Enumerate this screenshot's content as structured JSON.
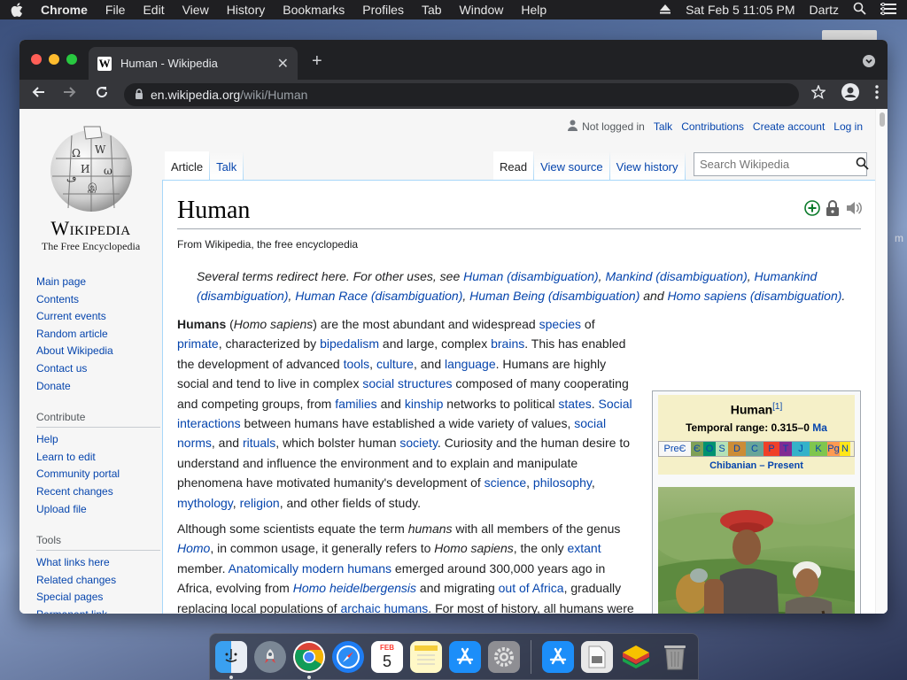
{
  "menubar": {
    "app_name": "Chrome",
    "items": [
      "File",
      "Edit",
      "View",
      "History",
      "Bookmarks",
      "Profiles",
      "Tab",
      "Window",
      "Help"
    ],
    "datetime": "Sat Feb 5  11:05 PM",
    "user": "Dartz"
  },
  "desktop": {
    "side_label": "m"
  },
  "browser": {
    "tab_title": "Human - Wikipedia",
    "favicon_letter": "W",
    "url_host": "en.wikipedia.org",
    "url_path": "/wiki/Human"
  },
  "wiki": {
    "wordmark": "Wikipedia",
    "tagline": "The Free Encyclopedia",
    "nav": [
      "Main page",
      "Contents",
      "Current events",
      "Random article",
      "About Wikipedia",
      "Contact us",
      "Donate"
    ],
    "contribute_heading": "Contribute",
    "contribute": [
      "Help",
      "Learn to edit",
      "Community portal",
      "Recent changes",
      "Upload file"
    ],
    "tools_heading": "Tools",
    "tools": [
      "What links here",
      "Related changes",
      "Special pages",
      "Permanent link"
    ],
    "personal": {
      "not_logged_in": "Not logged in",
      "talk": "Talk",
      "contributions": "Contributions",
      "create_account": "Create account",
      "log_in": "Log in"
    },
    "tabs_left": [
      "Article",
      "Talk"
    ],
    "tabs_right": [
      "Read",
      "View source",
      "View history"
    ],
    "search_placeholder": "Search Wikipedia",
    "title": "Human",
    "sitesub": "From Wikipedia, the free encyclopedia",
    "hatnote": {
      "prefix": "Several terms redirect here. For other uses, see ",
      "l1": "Human (disambiguation)",
      "s1": ", ",
      "l2": "Mankind (disambiguation)",
      "s2": ", ",
      "l3": "Humankind (disambiguation)",
      "s3": ", ",
      "l4": "Human Race (disambiguation)",
      "s4": ", ",
      "l5": "Human Being (disambiguation)",
      "s5": " and ",
      "l6": "Homo sapiens (disambiguation)",
      "s6": "."
    },
    "para1": [
      {
        "t": "Humans",
        "b": true
      },
      {
        "t": " ("
      },
      {
        "t": "Homo sapiens",
        "i": true
      },
      {
        "t": ") are the most abundant and widespread "
      },
      {
        "t": "species",
        "l": true
      },
      {
        "t": " of "
      },
      {
        "t": "primate",
        "l": true
      },
      {
        "t": ", characterized by "
      },
      {
        "t": "bipedalism",
        "l": true
      },
      {
        "t": " and large, complex "
      },
      {
        "t": "brains",
        "l": true
      },
      {
        "t": ". This has enabled the development of advanced "
      },
      {
        "t": "tools",
        "l": true
      },
      {
        "t": ", "
      },
      {
        "t": "culture",
        "l": true
      },
      {
        "t": ", and "
      },
      {
        "t": "language",
        "l": true
      },
      {
        "t": ". Humans are highly social and tend to live in complex "
      },
      {
        "t": "social structures",
        "l": true
      },
      {
        "t": " composed of many cooperating and competing groups, from "
      },
      {
        "t": "families",
        "l": true
      },
      {
        "t": " and "
      },
      {
        "t": "kinship",
        "l": true
      },
      {
        "t": " networks to political "
      },
      {
        "t": "states",
        "l": true
      },
      {
        "t": ". "
      },
      {
        "t": "Social interactions",
        "l": true
      },
      {
        "t": " between humans have established a wide variety of values, "
      },
      {
        "t": "social norms",
        "l": true
      },
      {
        "t": ", and "
      },
      {
        "t": "rituals",
        "l": true
      },
      {
        "t": ", which bolster human "
      },
      {
        "t": "society",
        "l": true
      },
      {
        "t": ". Curiosity and the human desire to understand and influence the environment and to explain and manipulate phenomena have motivated humanity's development of "
      },
      {
        "t": "science",
        "l": true
      },
      {
        "t": ", "
      },
      {
        "t": "philosophy",
        "l": true
      },
      {
        "t": ", "
      },
      {
        "t": "mythology",
        "l": true
      },
      {
        "t": ", "
      },
      {
        "t": "religion",
        "l": true
      },
      {
        "t": ", and other fields of study."
      }
    ],
    "para2": [
      {
        "t": "Although some scientists equate the term "
      },
      {
        "t": "humans",
        "i": true
      },
      {
        "t": " with all members of the genus "
      },
      {
        "t": "Homo",
        "l": true,
        "i": true
      },
      {
        "t": ", in common usage, it generally refers to "
      },
      {
        "t": "Homo sapiens",
        "i": true
      },
      {
        "t": ", the only "
      },
      {
        "t": "extant",
        "l": true
      },
      {
        "t": " member. "
      },
      {
        "t": "Anatomically modern humans",
        "l": true
      },
      {
        "t": " emerged around 300,000 years ago in Africa, evolving from "
      },
      {
        "t": "Homo heidelbergensis",
        "l": true,
        "i": true
      },
      {
        "t": " and migrating "
      },
      {
        "t": "out of Africa",
        "l": true
      },
      {
        "t": ", gradually replacing local populations of "
      },
      {
        "t": "archaic humans",
        "l": true
      },
      {
        "t": ". For most of history, all humans were"
      }
    ],
    "infobox": {
      "title": "Human",
      "ref": "[1]",
      "range_label": "Temporal range: 0.315–0 ",
      "range_link": "Ma",
      "timeline": [
        {
          "label": "PreЄ",
          "color": "#f7f7f7",
          "w": 36
        },
        {
          "label": "Є",
          "color": "#7fa056",
          "w": 14
        },
        {
          "label": "O",
          "color": "#009270",
          "w": 14
        },
        {
          "label": "S",
          "color": "#b3e1b6",
          "w": 14
        },
        {
          "label": "D",
          "color": "#cb8c37",
          "w": 20
        },
        {
          "label": "C",
          "color": "#67a599",
          "w": 20
        },
        {
          "label": "P",
          "color": "#f04028",
          "w": 18
        },
        {
          "label": "T",
          "color": "#812b92",
          "w": 14
        },
        {
          "label": "J",
          "color": "#34b2c9",
          "w": 20
        },
        {
          "label": "K",
          "color": "#7fc64e",
          "w": 20
        },
        {
          "label": "Pg",
          "color": "#fd9a52",
          "w": 14
        },
        {
          "label": "N",
          "color": "#ffe619",
          "w": 12
        }
      ],
      "sub_link": "Chibanian – Present"
    }
  },
  "dock": {
    "calendar_month": "FEB",
    "calendar_day": "5"
  }
}
